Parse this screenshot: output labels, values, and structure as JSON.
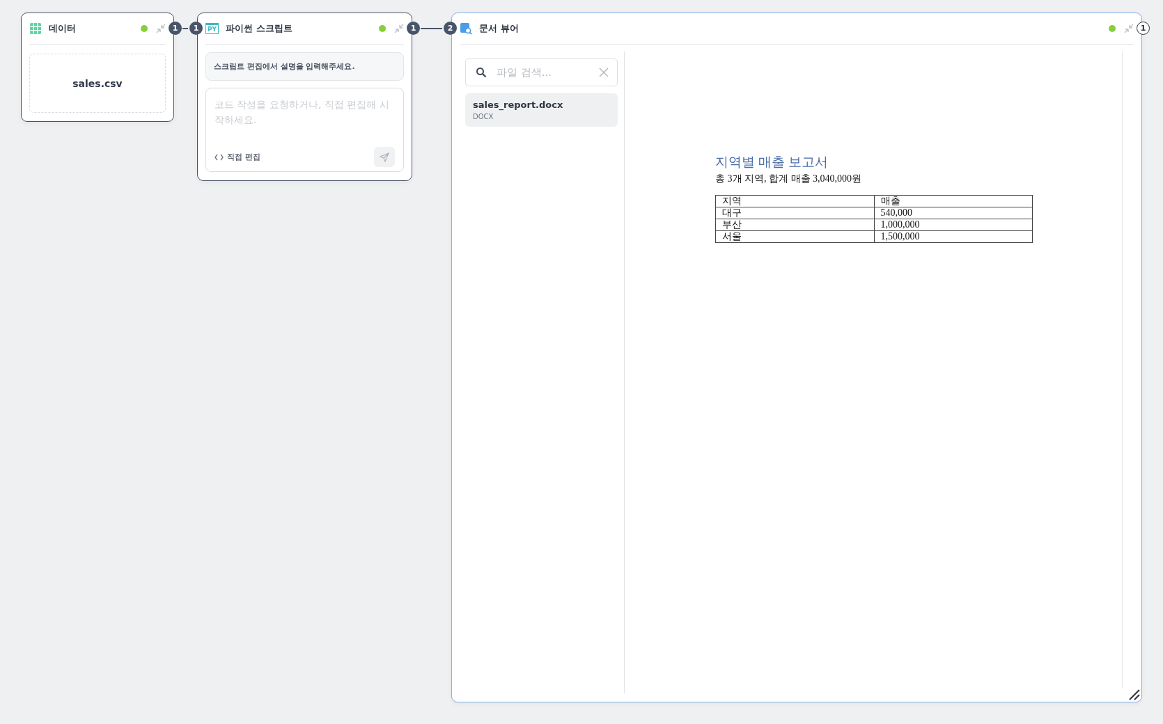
{
  "nodes": [
    {
      "kind": "data",
      "title": "데이터",
      "active": true,
      "selected": false,
      "ports_out": [
        "1"
      ],
      "file": "sales.csv"
    },
    {
      "kind": "script",
      "title": "파이썬 스크립트",
      "active": true,
      "selected": false,
      "ports_in": [
        "1"
      ],
      "ports_out": [
        "1"
      ],
      "icon_text": "PY",
      "description": "스크립트 편집에서 설명을 입력해주세요.",
      "prompt": {
        "placeholder": "코드 작성을 요청하거나, 직접 편집해 시작하세요."
      },
      "edit_link": "직접 편집"
    },
    {
      "kind": "viewer",
      "title": "문서 뷰어",
      "active": true,
      "selected": true,
      "ports_in": [
        "2"
      ],
      "ports_out": [
        "1"
      ],
      "search": {
        "placeholder": "파일 검색..."
      },
      "files": [
        {
          "name": "sales_report.docx",
          "type": "DOCX",
          "selected": true
        }
      ],
      "document": {
        "title": "지역별 매출 보고서",
        "summary": "총 3개 지역, 합계 매출 3,040,000원",
        "columns": [
          "지역",
          "매출"
        ],
        "rows": [
          [
            "대구",
            "540,000"
          ],
          [
            "부산",
            "1,000,000"
          ],
          [
            "서울",
            "1,500,000"
          ]
        ]
      }
    }
  ]
}
